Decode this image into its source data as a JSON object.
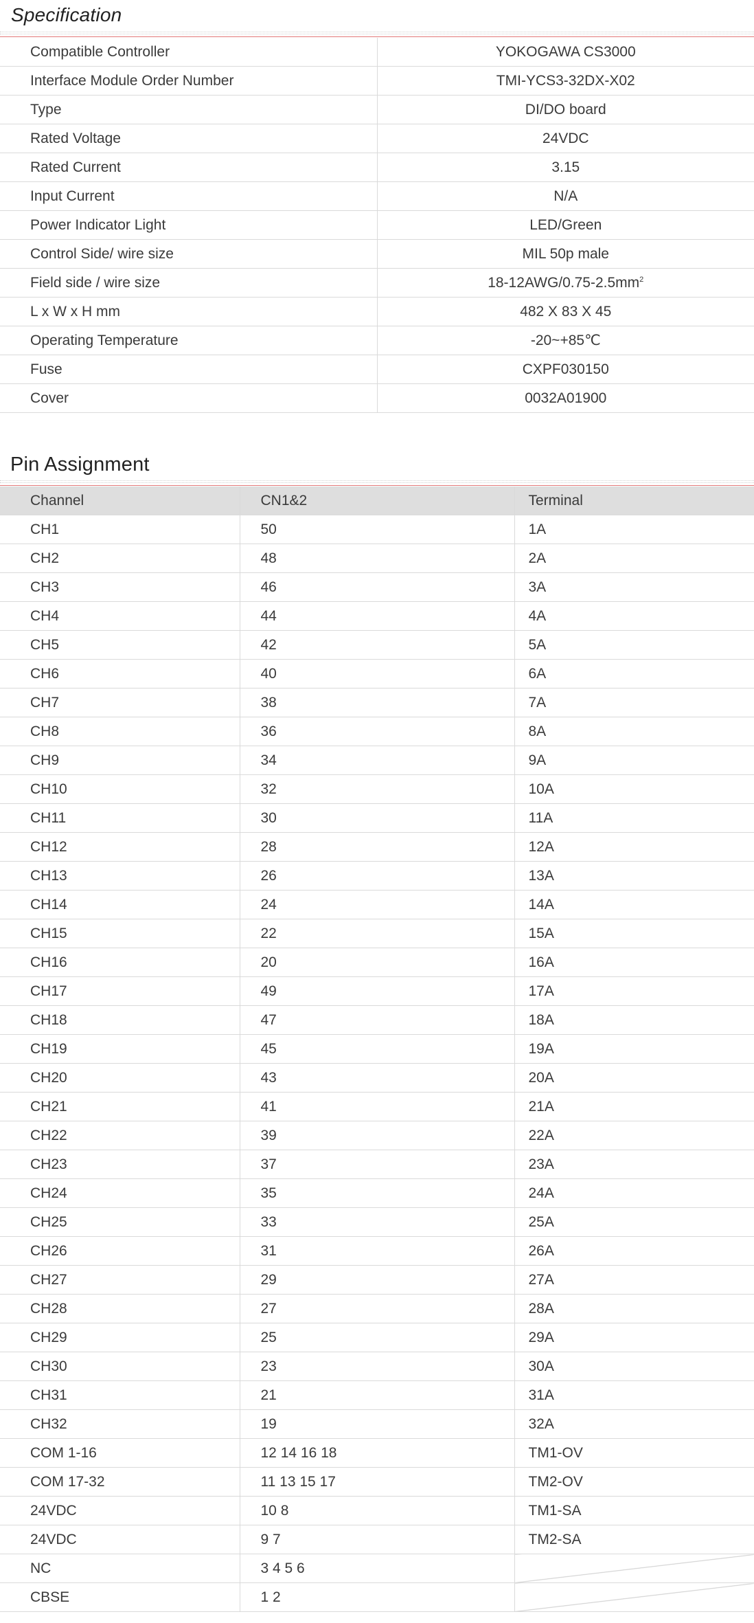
{
  "specification": {
    "title": "Specification",
    "rows": [
      {
        "key": "Compatible Controller",
        "value": "YOKOGAWA CS3000"
      },
      {
        "key": "Interface Module Order Number",
        "value": "TMI-YCS3-32DX-X02"
      },
      {
        "key": "Type",
        "value": "DI/DO board"
      },
      {
        "key": "Rated Voltage",
        "value": "24VDC"
      },
      {
        "key": "Rated Current",
        "value": "3.15"
      },
      {
        "key": "Input Current",
        "value": "N/A"
      },
      {
        "key": "Power Indicator Light",
        "value": "LED/Green"
      },
      {
        "key": "Control Side/ wire size",
        "value": "MIL 50p male"
      },
      {
        "key": "Field side / wire size",
        "value": "18-12AWG/0.75-2.5mm",
        "sup": "2"
      },
      {
        "key": "L x W x H mm",
        "value": "482 X 83 X 45"
      },
      {
        "key": "Operating Temperature",
        "value": "-20~+85℃"
      },
      {
        "key": "Fuse",
        "value": "CXPF030150"
      },
      {
        "key": "Cover",
        "value": "0032A01900"
      }
    ]
  },
  "pin_assignment": {
    "title": "Pin Assignment",
    "headers": [
      "Channel",
      "CN1&2",
      "Terminal"
    ],
    "rows": [
      [
        "CH1",
        "50",
        "1A"
      ],
      [
        "CH2",
        "48",
        "2A"
      ],
      [
        "CH3",
        "46",
        "3A"
      ],
      [
        "CH4",
        "44",
        "4A"
      ],
      [
        "CH5",
        "42",
        "5A"
      ],
      [
        "CH6",
        "40",
        "6A"
      ],
      [
        "CH7",
        "38",
        "7A"
      ],
      [
        "CH8",
        "36",
        "8A"
      ],
      [
        "CH9",
        "34",
        "9A"
      ],
      [
        "CH10",
        "32",
        "10A"
      ],
      [
        "CH11",
        "30",
        "11A"
      ],
      [
        "CH12",
        "28",
        "12A"
      ],
      [
        "CH13",
        "26",
        "13A"
      ],
      [
        "CH14",
        "24",
        "14A"
      ],
      [
        "CH15",
        "22",
        "15A"
      ],
      [
        "CH16",
        "20",
        "16A"
      ],
      [
        "CH17",
        "49",
        "17A"
      ],
      [
        "CH18",
        "47",
        "18A"
      ],
      [
        "CH19",
        "45",
        "19A"
      ],
      [
        "CH20",
        "43",
        "20A"
      ],
      [
        "CH21",
        "41",
        "21A"
      ],
      [
        "CH22",
        "39",
        "22A"
      ],
      [
        "CH23",
        "37",
        "23A"
      ],
      [
        "CH24",
        "35",
        "24A"
      ],
      [
        "CH25",
        "33",
        "25A"
      ],
      [
        "CH26",
        "31",
        "26A"
      ],
      [
        "CH27",
        "29",
        "27A"
      ],
      [
        "CH28",
        "27",
        "28A"
      ],
      [
        "CH29",
        "25",
        "29A"
      ],
      [
        "CH30",
        "23",
        "30A"
      ],
      [
        "CH31",
        "21",
        "31A"
      ],
      [
        "CH32",
        "19",
        "32A"
      ],
      [
        "COM 1-16",
        "12  14  16  18",
        "TM1-OV"
      ],
      [
        "COM 17-32",
        "11  13  15  17",
        "TM2-OV"
      ],
      [
        "24VDC",
        "10  8",
        "TM1-SA"
      ],
      [
        "24VDC",
        "9  7",
        "TM2-SA"
      ],
      [
        "NC",
        "3  4  5  6",
        ""
      ],
      [
        "CBSE",
        "1  2",
        ""
      ]
    ]
  },
  "colors": {
    "accent_rule": "#e27878",
    "header_bg": "#dedede",
    "grid": "#dadada"
  }
}
